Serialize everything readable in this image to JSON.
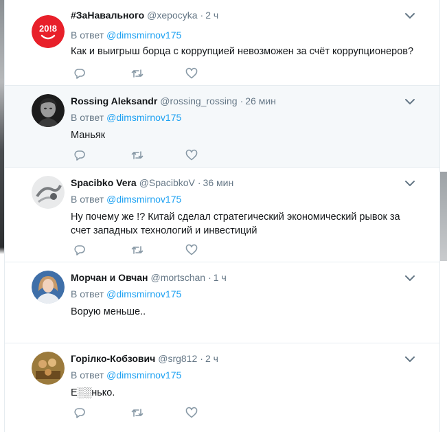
{
  "tweets": [
    {
      "fullname": "#ЗаНавального",
      "handle": "@xepocyka",
      "time": "2 ч",
      "reply_prefix": "В ответ",
      "reply_to": "@dimsmirnov175",
      "text": "Как и выигрыш борца с коррупцией невозможен за счёт коррупционеров?",
      "avatar_text": "20!8",
      "icons": [
        "reply-icon",
        "retweet-icon",
        "like-icon",
        "chevron-down-icon"
      ]
    },
    {
      "fullname": "Rossing Aleksandr",
      "handle": "@rossing_rossing",
      "time": "26 мин",
      "reply_prefix": "В ответ",
      "reply_to": "@dimsmirnov175",
      "text": "Маньяк"
    },
    {
      "fullname": "Spacibko Vera",
      "handle": "@SpacibkoV",
      "time": "36 мин",
      "reply_prefix": "В ответ",
      "reply_to": "@dimsmirnov175",
      "text": "Ну почему же !? Китай сделал стратегический экономический рывок за счет западных технологий и инвестиций"
    },
    {
      "fullname": "Морчан и Овчан",
      "handle": "@mortschan",
      "time": "1 ч",
      "reply_prefix": "В ответ",
      "reply_to": "@dimsmirnov175",
      "text": "Ворую меньше.."
    },
    {
      "fullname": "Горілко-Кобзович",
      "handle": "@srg812",
      "time": "2 ч",
      "reply_prefix": "В ответ",
      "reply_to": "@dimsmirnov175",
      "text": "Е░░нько."
    }
  ],
  "colors": {
    "accent": "#1da1f2",
    "secondary_text": "#657786",
    "highlight_bg": "#f5f8fa",
    "avatar_red": "#e8202a"
  }
}
